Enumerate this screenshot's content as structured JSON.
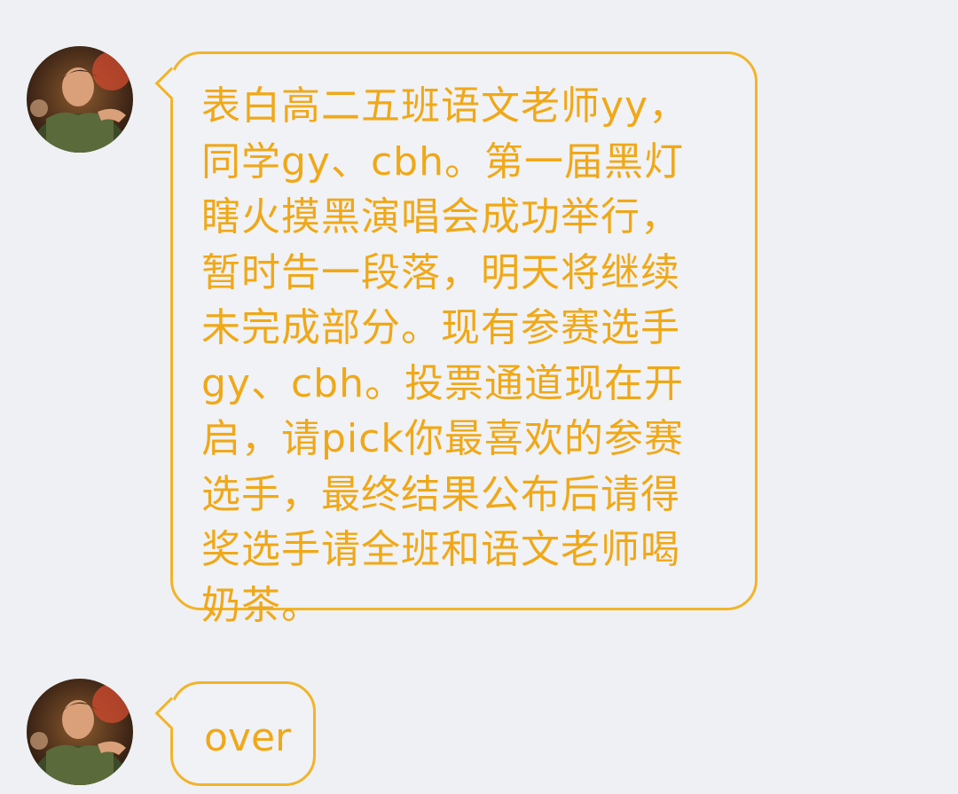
{
  "messages": [
    {
      "sender_avatar_icon": "profile-photo",
      "lines": [
        "表白高二五班语文老师yy，",
        "同学gy、cbh。第一届黑灯",
        "瞎火摸黑演唱会成功举行，",
        "暂时告一段落，明天将继续",
        "未完成部分。现有参赛选手",
        "gy、cbh。投票通道现在开",
        "启，请pick你最喜欢的参赛",
        "选手，最终结果公布后请得",
        "奖选手请全班和语文老师喝",
        "奶茶。"
      ]
    },
    {
      "sender_avatar_icon": "profile-photo",
      "lines": [
        "over"
      ]
    }
  ],
  "colors": {
    "background": "#eef0f3",
    "bubble_border": "#f1b42a",
    "text": "#f0a818"
  }
}
